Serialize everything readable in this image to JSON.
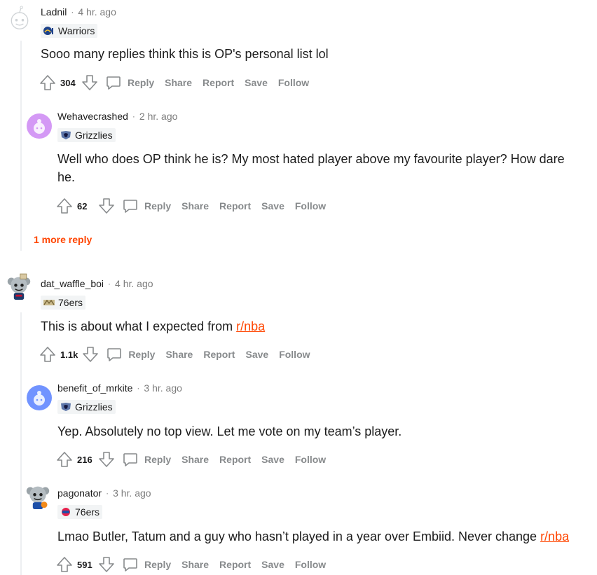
{
  "actions": {
    "reply": "Reply",
    "share": "Share",
    "report": "Report",
    "save": "Save",
    "follow": "Follow"
  },
  "comments": [
    {
      "username": "Ladnil",
      "time": "4 hr. ago",
      "flair": "Warriors",
      "body": "Sooo many replies think this is OP's personal list lol",
      "score": "304"
    },
    {
      "username": "Wehavecrashed",
      "time": "2 hr. ago",
      "flair": "Grizzlies",
      "body": "Well who does OP think he is? My most hated player above my favourite player? How dare he.",
      "score": "62"
    },
    {
      "username": "dat_waffle_boi",
      "time": "4 hr. ago",
      "flair": "76ers",
      "body_prefix": "This is about what I expected from ",
      "body_link": "r/nba",
      "score": "1.1k"
    },
    {
      "username": "benefit_of_mrkite",
      "time": "3 hr. ago",
      "flair": "Grizzlies",
      "body": "Yep. Absolutely no top view. Let me vote on my team’s player.",
      "score": "216"
    },
    {
      "username": "pagonator",
      "time": "3 hr. ago",
      "flair": "76ers",
      "body_prefix": "Lmao Butler, Tatum and a guy who hasn’t played in a year over Embiid. Never change ",
      "body_link": "r/nba",
      "score": "591"
    }
  ],
  "more_replies": "1 more reply",
  "colors": {
    "accent": "#ff4500",
    "muted": "#878a8c",
    "flair_bg": "#f2f4f5"
  }
}
